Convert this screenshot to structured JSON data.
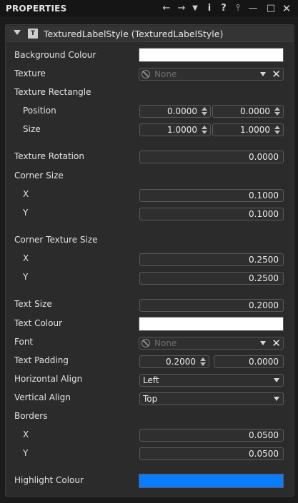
{
  "window": {
    "title": "PROPERTIES",
    "icons": [
      "back-icon",
      "forward-icon",
      "dropdown-icon",
      "info-icon",
      "help-icon",
      "pin-icon",
      "minimize-icon",
      "maximize-icon",
      "close-icon"
    ]
  },
  "component": {
    "title": "TexturedLabelStyle (TexturedLabelStyle)",
    "icon_glyph": "T"
  },
  "props": {
    "background_colour": {
      "label": "Background Colour",
      "color": "#ffffff"
    },
    "texture": {
      "label": "Texture",
      "value": "None"
    },
    "texture_rect": {
      "label": "Texture Rectangle",
      "position": {
        "label": "Position",
        "x": "0.0000",
        "y": "0.0000"
      },
      "size": {
        "label": "Size",
        "x": "1.0000",
        "y": "1.0000"
      }
    },
    "texture_rotation": {
      "label": "Texture Rotation",
      "value": "0.0000"
    },
    "corner_size": {
      "label": "Corner Size",
      "x_label": "X",
      "x": "0.1000",
      "y_label": "Y",
      "y": "0.1000"
    },
    "corner_texture_size": {
      "label": "Corner Texture Size",
      "x_label": "X",
      "x": "0.2500",
      "y_label": "Y",
      "y": "0.2500"
    },
    "text_size": {
      "label": "Text Size",
      "value": "0.2000"
    },
    "text_colour": {
      "label": "Text Colour",
      "color": "#ffffff"
    },
    "font": {
      "label": "Font",
      "value": "None"
    },
    "text_padding": {
      "label": "Text Padding",
      "x": "0.2000",
      "y": "0.0000"
    },
    "horizontal_align": {
      "label": "Horizontal Align",
      "value": "Left"
    },
    "vertical_align": {
      "label": "Vertical Align",
      "value": "Top"
    },
    "borders": {
      "label": "Borders",
      "x_label": "X",
      "x": "0.0500",
      "y_label": "Y",
      "y": "0.0500"
    },
    "highlight_colour": {
      "label": "Highlight Colour",
      "color": "#0a7cff"
    }
  }
}
